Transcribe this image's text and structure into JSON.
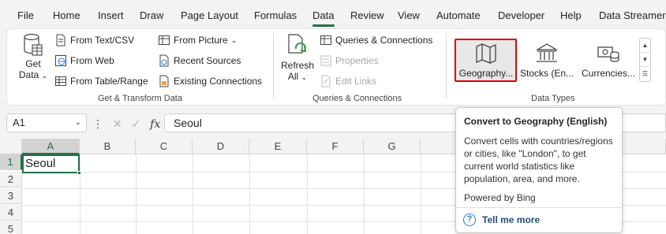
{
  "menu": {
    "tabs": [
      "File",
      "Home",
      "Insert",
      "Draw",
      "Page Layout",
      "Formulas",
      "Data",
      "Review",
      "View",
      "Automate",
      "Developer",
      "Help",
      "Data Streamer"
    ],
    "active": "Data"
  },
  "ribbon": {
    "get_transform": {
      "get_data_line1": "Get",
      "get_data_line2": "Data",
      "from_text_csv": "From Text/CSV",
      "from_web": "From Web",
      "from_table_range": "From Table/Range",
      "from_picture": "From Picture",
      "recent_sources": "Recent Sources",
      "existing_connections": "Existing Connections",
      "label": "Get & Transform Data"
    },
    "queries": {
      "refresh_line1": "Refresh",
      "refresh_line2": "All",
      "queries_connections": "Queries & Connections",
      "properties": "Properties",
      "edit_links": "Edit Links",
      "label": "Queries & Connections"
    },
    "data_types": {
      "geography": "Geography...",
      "stocks": "Stocks (En...",
      "currencies": "Currencies...",
      "label": "Data Types"
    }
  },
  "formula_bar": {
    "name_box": "A1",
    "fx": "fx",
    "value": "Seoul"
  },
  "grid": {
    "columns": [
      "A",
      "B",
      "C",
      "D",
      "E",
      "F",
      "G"
    ],
    "rows": [
      "1",
      "2",
      "3",
      "4",
      "5"
    ],
    "a1": "Seoul"
  },
  "tooltip": {
    "title": "Convert to Geography (English)",
    "body_lines": [
      "Convert cells with countries/regions",
      "or cities, like \"London\", to get",
      "current world statistics like",
      "population, area, and more."
    ],
    "powered": "Powered by Bing",
    "tell_more": "Tell me more"
  },
  "colors": {
    "accent": "#217346",
    "highlight": "#e00000"
  }
}
